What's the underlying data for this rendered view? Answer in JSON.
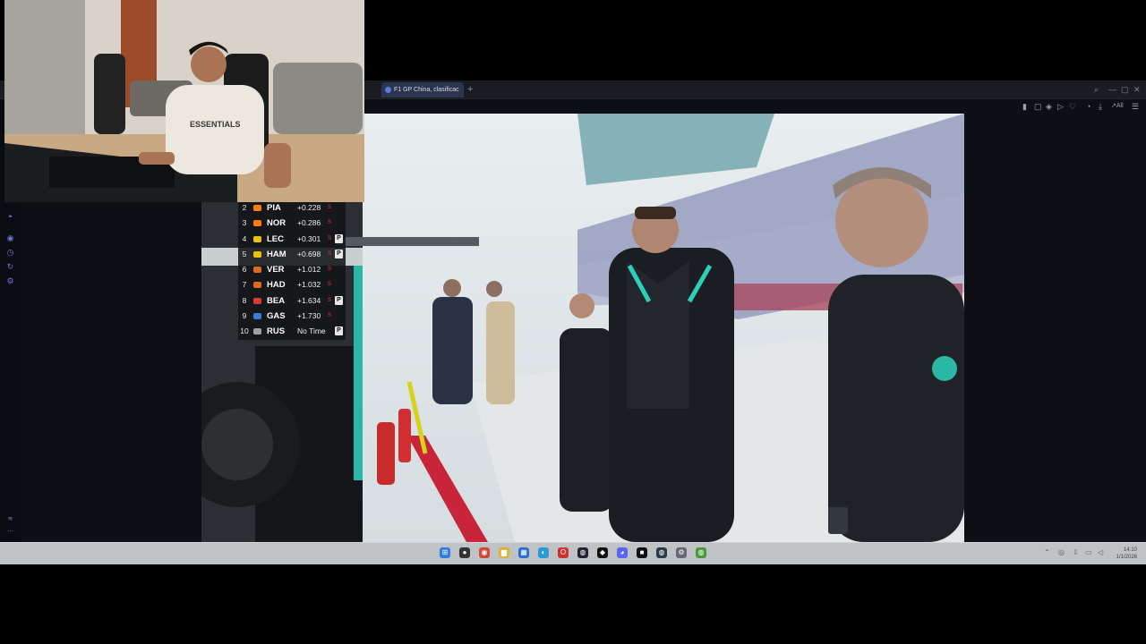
{
  "browser": {
    "tab_title": "F1 GP China, clasificac",
    "new_tab": "+",
    "window_controls": [
      "search-icon",
      "minimize-icon",
      "maximize-icon",
      "close-icon"
    ],
    "toolbar_right_label": "All"
  },
  "leaderboard": [
    {
      "pos": "2",
      "code": "PIA",
      "gap": "+0.228",
      "tyre": "S",
      "pit": "",
      "color": "#ff8000"
    },
    {
      "pos": "3",
      "code": "NOR",
      "gap": "+0.286",
      "tyre": "S",
      "pit": "",
      "color": "#ff8000"
    },
    {
      "pos": "4",
      "code": "LEC",
      "gap": "+0.301",
      "tyre": "S",
      "pit": "P",
      "color": "#e8c400"
    },
    {
      "pos": "5",
      "code": "HAM",
      "gap": "+0.698",
      "tyre": "S",
      "pit": "P",
      "color": "#e8c400"
    },
    {
      "pos": "6",
      "code": "VER",
      "gap": "+1.012",
      "tyre": "S",
      "pit": "",
      "color": "#e06a1a"
    },
    {
      "pos": "7",
      "code": "HAD",
      "gap": "+1.032",
      "tyre": "S",
      "pit": "",
      "color": "#e06a1a"
    },
    {
      "pos": "8",
      "code": "BEA",
      "gap": "+1.634",
      "tyre": "S",
      "pit": "P",
      "color": "#d63a3a"
    },
    {
      "pos": "9",
      "code": "GAS",
      "gap": "+1.730",
      "tyre": "S",
      "pit": "",
      "color": "#3a7bd5"
    },
    {
      "pos": "10",
      "code": "RUS",
      "gap": "No Time",
      "tyre": "",
      "pit": "P",
      "color": "#9aa0a6"
    }
  ],
  "webcam": {
    "shirt_text": "ESSENTIALS"
  },
  "taskbar": {
    "icons": [
      {
        "name": "windows-start-icon",
        "glyph": "⊞",
        "color": "#2f7de0"
      },
      {
        "name": "app-icon-1",
        "glyph": "●",
        "color": "#333"
      },
      {
        "name": "chrome-icon",
        "glyph": "◉",
        "color": "#d04a3a"
      },
      {
        "name": "file-explorer-icon",
        "glyph": "▆",
        "color": "#e0b030"
      },
      {
        "name": "store-icon",
        "glyph": "▦",
        "color": "#2a6fd0"
      },
      {
        "name": "edge-icon",
        "glyph": "◐",
        "color": "#2a9ad8"
      },
      {
        "name": "opera-icon",
        "glyph": "O",
        "color": "#d03030"
      },
      {
        "name": "steam-icon",
        "glyph": "◍",
        "color": "#223"
      },
      {
        "name": "epic-icon",
        "glyph": "◆",
        "color": "#111"
      },
      {
        "name": "discord-icon",
        "glyph": "◕",
        "color": "#5865f2"
      },
      {
        "name": "app-icon-2",
        "glyph": "■",
        "color": "#111"
      },
      {
        "name": "steam-active-icon",
        "glyph": "◍",
        "color": "#2b3a4a"
      },
      {
        "name": "settings-icon",
        "glyph": "⚙",
        "color": "#667"
      },
      {
        "name": "green-app-icon",
        "glyph": "◍",
        "color": "#4a9a3a"
      }
    ],
    "time": "14:10",
    "date": "1/1/2026"
  }
}
